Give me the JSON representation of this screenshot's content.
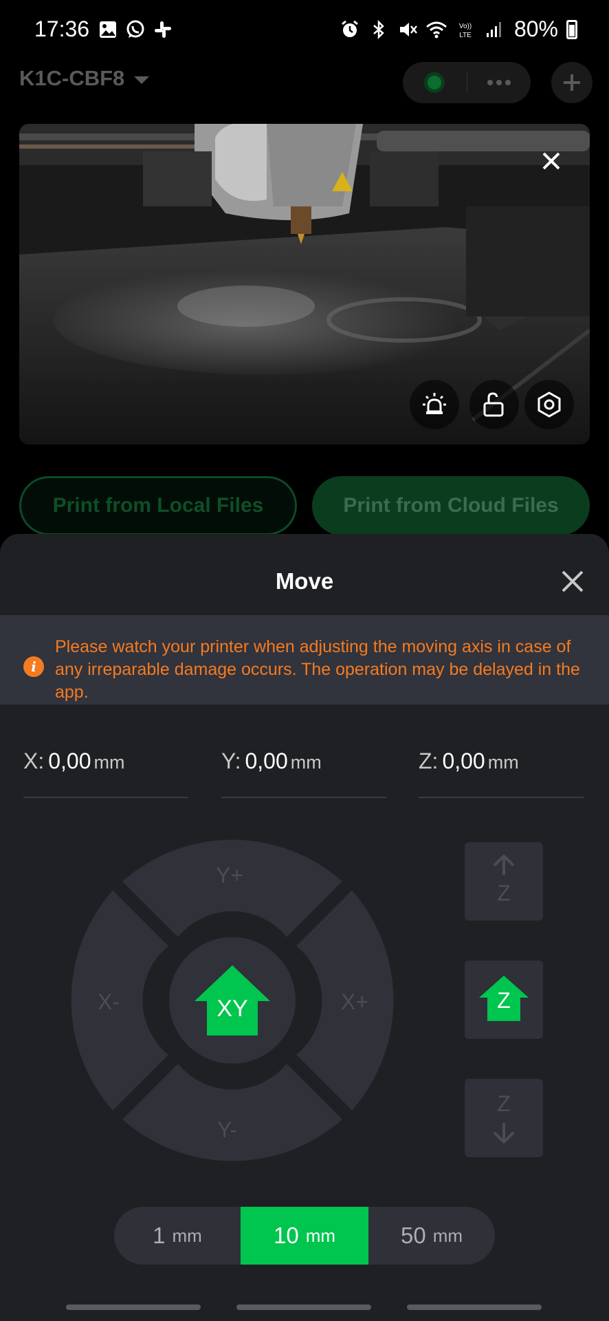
{
  "status_bar": {
    "time": "17:36",
    "battery": "80%",
    "icons": [
      "gallery-icon",
      "whatsapp-icon",
      "slack-icon",
      "alarm-icon",
      "bluetooth-icon",
      "mute-icon",
      "wifi-icon",
      "volte-icon",
      "signal-icon",
      "battery-icon"
    ]
  },
  "header": {
    "device_name": "K1C-CBF8"
  },
  "actions": {
    "print_local": "Print from Local Files",
    "print_cloud": "Print from Cloud Files"
  },
  "move_sheet": {
    "title": "Move",
    "warning": "Please watch your printer when adjusting the moving axis in case of any irreparable damage occurs. The operation may be delayed in the app.",
    "coords": [
      {
        "label": "X:",
        "value": "0,00",
        "unit": "mm"
      },
      {
        "label": "Y:",
        "value": "0,00",
        "unit": "mm"
      },
      {
        "label": "Z:",
        "value": "0,00",
        "unit": "mm"
      }
    ],
    "jog": {
      "y_plus": "Y+",
      "y_minus": "Y-",
      "x_minus": "X-",
      "x_plus": "X+",
      "home_xy": "XY",
      "home_z": "Z",
      "z_up": "Z",
      "z_down": "Z"
    },
    "steps": [
      {
        "value": "1",
        "unit": "mm"
      },
      {
        "value": "10",
        "unit": "mm"
      },
      {
        "value": "50",
        "unit": "mm"
      }
    ],
    "selected_step": "10 mm"
  },
  "colors": {
    "accent": "#00c54e",
    "warning": "#f47b20",
    "sheet": "#1f2024"
  }
}
